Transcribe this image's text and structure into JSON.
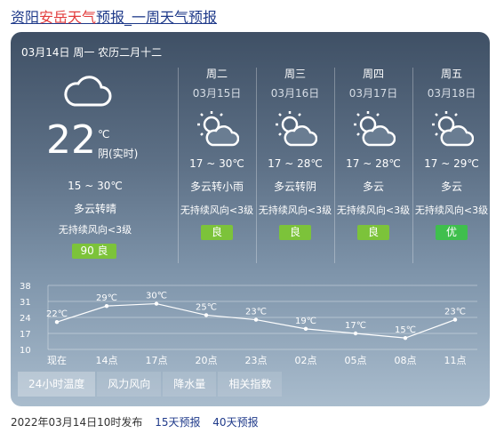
{
  "title": {
    "city": "资阳",
    "location": "安岳天气",
    "suffix": "预报_一周天气预报"
  },
  "today": {
    "date": "03月14日 周一 农历二月十二",
    "temp": "22",
    "unit": "℃",
    "now_label": "阴(实时)",
    "range": "15 ~ 30℃",
    "weather": "多云转晴",
    "wind": "无持续风向<3级",
    "aqi": "90 良",
    "icon": "cloud-icon"
  },
  "days": [
    {
      "day": "周二",
      "date": "03月15日",
      "temp": "17 ~ 30℃",
      "weather": "多云转小雨",
      "wind": "无持续风向<3级",
      "aqi": "良",
      "aqi_color": "#7cc33a",
      "icon": "partly-cloudy-icon"
    },
    {
      "day": "周三",
      "date": "03月16日",
      "temp": "17 ~ 28℃",
      "weather": "多云转阴",
      "wind": "无持续风向<3级",
      "aqi": "良",
      "aqi_color": "#7cc33a",
      "icon": "partly-cloudy-icon"
    },
    {
      "day": "周四",
      "date": "03月17日",
      "temp": "17 ~ 28℃",
      "weather": "多云",
      "wind": "无持续风向<3级",
      "aqi": "良",
      "aqi_color": "#7cc33a",
      "icon": "partly-cloudy-icon"
    },
    {
      "day": "周五",
      "date": "03月18日",
      "temp": "17 ~ 29℃",
      "weather": "多云",
      "wind": "无持续风向<3级",
      "aqi": "优",
      "aqi_color": "#3fbf4d",
      "icon": "partly-cloudy-icon"
    }
  ],
  "chart_data": {
    "type": "line",
    "x": [
      "现在",
      "14点",
      "17点",
      "20点",
      "23点",
      "02点",
      "05点",
      "08点",
      "11点"
    ],
    "values": [
      22,
      29,
      30,
      25,
      23,
      19,
      17,
      15,
      23
    ],
    "point_labels": [
      "22℃",
      "29℃",
      "30℃",
      "25℃",
      "23℃",
      "19℃",
      "17℃",
      "15℃",
      "23℃"
    ],
    "yticks": [
      38,
      31,
      24,
      17,
      10
    ],
    "ylim": [
      10,
      38
    ],
    "grid": true
  },
  "tabs": [
    "24小时温度",
    "风力风向",
    "降水量",
    "相关指数"
  ],
  "footer": {
    "published": "2022年03月14日10时发布",
    "link1": "15天预报",
    "link2": "40天预报"
  }
}
